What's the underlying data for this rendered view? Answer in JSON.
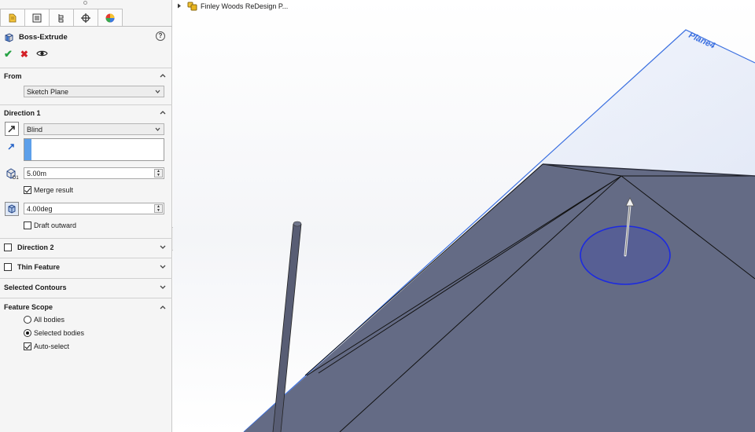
{
  "panel": {
    "tabs": [
      {
        "icon": "feature-manager-icon"
      },
      {
        "icon": "property-manager-icon"
      },
      {
        "icon": "configuration-manager-icon"
      },
      {
        "icon": "dimxpert-icon"
      },
      {
        "icon": "display-manager-icon"
      }
    ],
    "title": "Boss-Extrude",
    "help": "?",
    "from": {
      "header": "From",
      "value": "Sketch Plane"
    },
    "direction1": {
      "header": "Direction 1",
      "end_condition": "Blind",
      "depth": "5.00m",
      "merge_result": "Merge result",
      "merge_checked": true,
      "draft_angle": "4.00deg",
      "draft_outward": "Draft outward",
      "draft_outward_checked": false
    },
    "direction2": {
      "header": "Direction 2",
      "checked": false
    },
    "thin_feature": {
      "header": "Thin Feature",
      "checked": false
    },
    "selected_contours": {
      "header": "Selected Contours"
    },
    "feature_scope": {
      "header": "Feature Scope",
      "all_bodies": "All bodies",
      "selected_bodies": "Selected bodies",
      "auto_select": "Auto-select",
      "selected_option": "Selected bodies",
      "auto_select_checked": true
    }
  },
  "viewport": {
    "tree_item": "Finley Woods ReDesign P...",
    "plane_label": "Plane4",
    "colors": {
      "body": "#646b85",
      "plane_edge": "#3a6fe0",
      "circle_fill": "#575f94",
      "circle_edge": "#1c2ae0"
    }
  }
}
